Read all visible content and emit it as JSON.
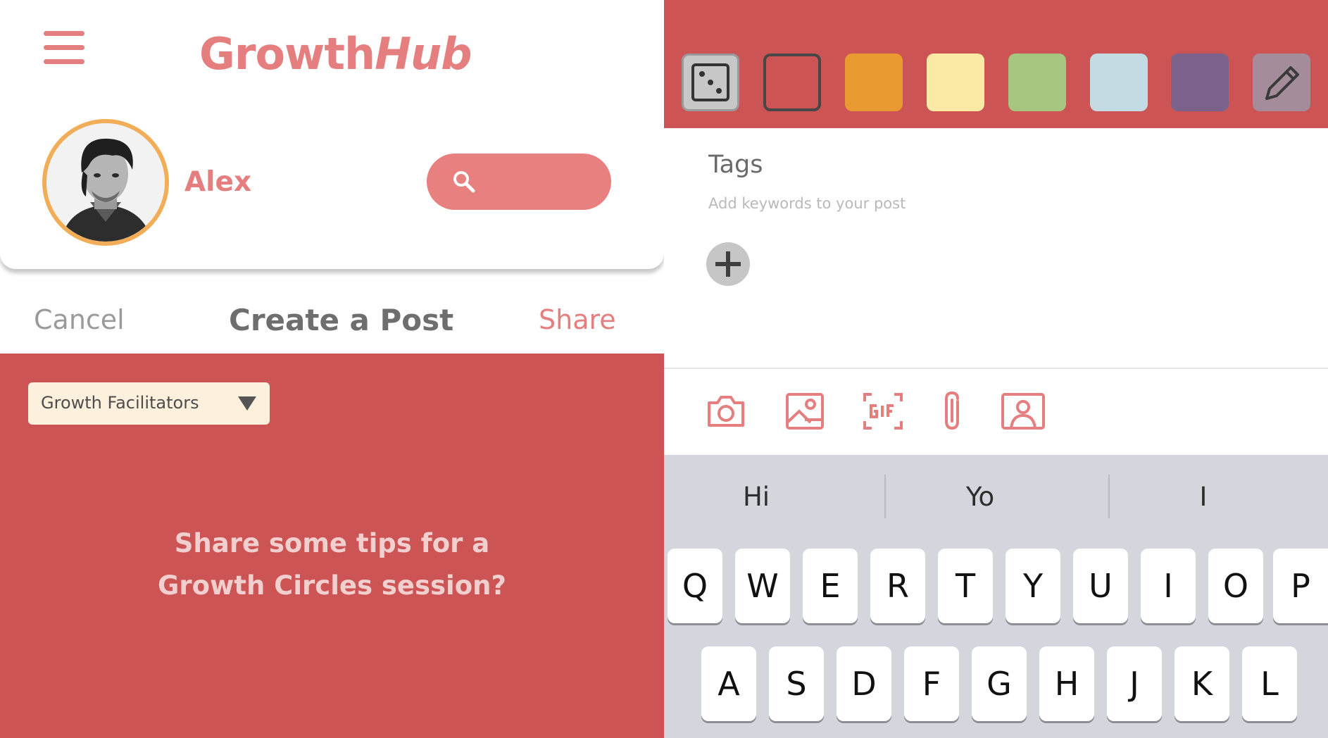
{
  "app": {
    "logo_prefix": "Growth",
    "logo_suffix": "Hub",
    "user_name": "Alex"
  },
  "post_bar": {
    "cancel_label": "Cancel",
    "title": "Create a Post",
    "share_label": "Share"
  },
  "compose": {
    "audience": "Growth Facilitators",
    "placeholder_line1": "Share some tips for a",
    "placeholder_line2": "Growth Circles session?"
  },
  "palette": {
    "swatches": [
      {
        "name": "random",
        "color": "#c7c7c7"
      },
      {
        "name": "red",
        "color": "#cc5454"
      },
      {
        "name": "orange",
        "color": "#e89a31"
      },
      {
        "name": "yellow",
        "color": "#fbeaa5"
      },
      {
        "name": "green",
        "color": "#a6c67f"
      },
      {
        "name": "light-blue",
        "color": "#c3dbe3"
      },
      {
        "name": "purple",
        "color": "#7b628a"
      },
      {
        "name": "custom-pencil",
        "color": "#a48c9a"
      }
    ],
    "selected": "red"
  },
  "tags": {
    "title": "Tags",
    "hint": "Add keywords to your post"
  },
  "media_icons": [
    "camera-icon",
    "image-icon",
    "gif-icon",
    "paperclip-icon",
    "contact-icon"
  ],
  "keyboard": {
    "suggestions": [
      "Hi",
      "Yo",
      "I"
    ],
    "row1": [
      "Q",
      "W",
      "E",
      "R",
      "T",
      "Y",
      "U",
      "I",
      "O",
      "P"
    ],
    "row2": [
      "A",
      "S",
      "D",
      "F",
      "G",
      "H",
      "J",
      "K",
      "L"
    ]
  },
  "colors": {
    "accent": "#e57e7f",
    "compose_bg": "#cc5454",
    "avatar_ring": "#f1ad58"
  }
}
